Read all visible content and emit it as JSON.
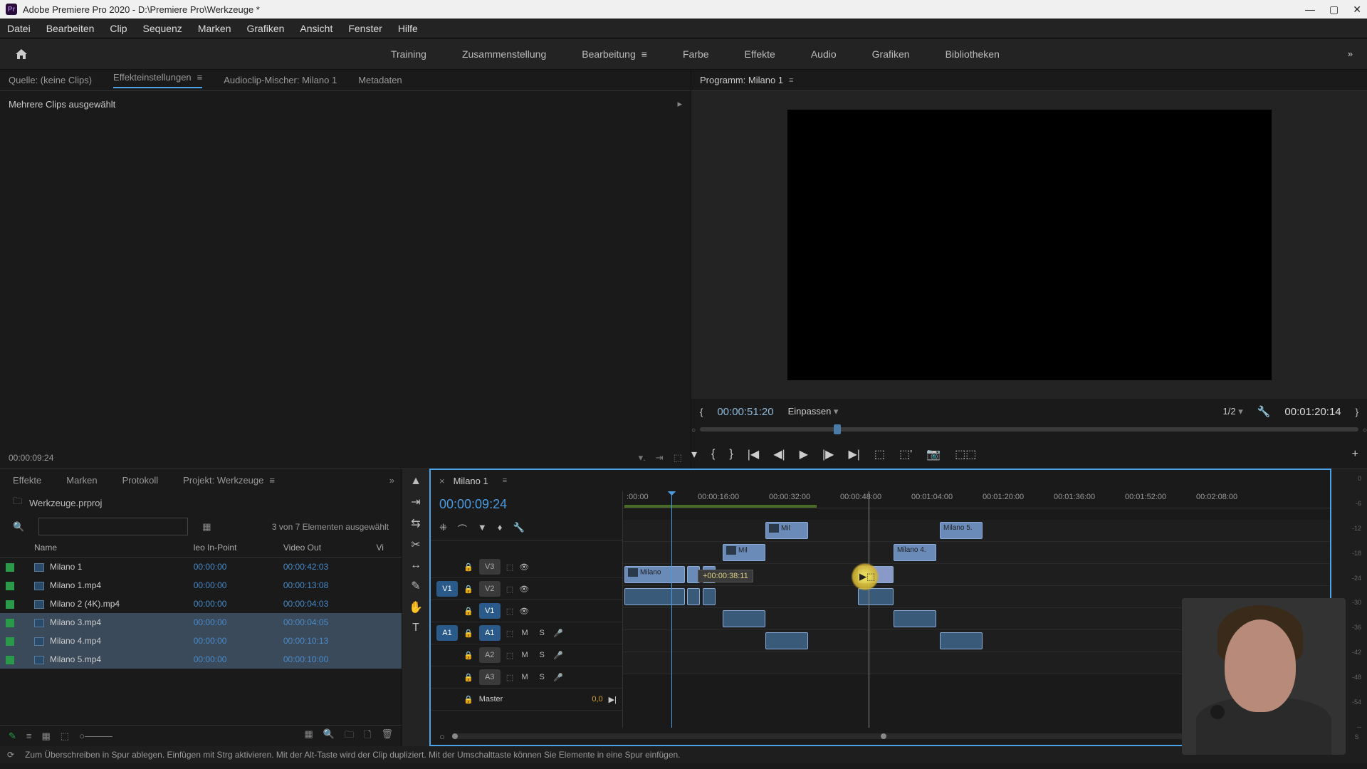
{
  "titlebar": {
    "title": "Adobe Premiere Pro 2020 - D:\\Premiere Pro\\Werkzeuge *"
  },
  "menu": [
    "Datei",
    "Bearbeiten",
    "Clip",
    "Sequenz",
    "Marken",
    "Grafiken",
    "Ansicht",
    "Fenster",
    "Hilfe"
  ],
  "workspaces": {
    "items": [
      "Training",
      "Zusammenstellung",
      "Bearbeitung",
      "Farbe",
      "Effekte",
      "Audio",
      "Grafiken",
      "Bibliotheken"
    ],
    "active": "Bearbeitung"
  },
  "source_tabs": {
    "items": [
      "Quelle: (keine Clips)",
      "Effekteinstellungen",
      "Audioclip-Mischer: Milano 1",
      "Metadaten"
    ],
    "active": "Effekteinstellungen"
  },
  "effect_panel": {
    "message": "Mehrere Clips ausgewählt"
  },
  "source_footer_tc": "00:00:09:24",
  "program": {
    "title": "Programm: Milano 1",
    "tc_left": "00:00:51:20",
    "fit": "Einpassen",
    "ratio": "1/2",
    "tc_right": "00:01:20:14"
  },
  "project_tabs": {
    "items": [
      "Effekte",
      "Marken",
      "Protokoll",
      "Projekt: Werkzeuge"
    ],
    "active": "Projekt: Werkzeuge"
  },
  "project": {
    "filename": "Werkzeuge.prproj",
    "selection_text": "3 von 7 Elementen ausgewählt",
    "columns": [
      "Name",
      "leo In-Point",
      "Video Out",
      "Vi"
    ],
    "rows": [
      {
        "name": "Milano 1",
        "in": "00:00:00",
        "out": "00:00:42:03",
        "selected": false,
        "type": "seq"
      },
      {
        "name": "Milano 1.mp4",
        "in": "00:00:00",
        "out": "00:00:13:08",
        "selected": false,
        "type": "clip"
      },
      {
        "name": "Milano 2 (4K).mp4",
        "in": "00:00:00",
        "out": "00:00:04:03",
        "selected": false,
        "type": "clip"
      },
      {
        "name": "Milano 3.mp4",
        "in": "00:00:00",
        "out": "00:00:04:05",
        "selected": true,
        "type": "clip"
      },
      {
        "name": "Milano 4.mp4",
        "in": "00:00:00",
        "out": "00:00:10:13",
        "selected": true,
        "type": "clip"
      },
      {
        "name": "Milano 5.mp4",
        "in": "00:00:00",
        "out": "00:00:10:00",
        "selected": true,
        "type": "clip"
      }
    ]
  },
  "timeline": {
    "seq_name": "Milano 1",
    "tc": "00:00:09:24",
    "ruler": [
      ":00:00",
      "00:00:16:00",
      "00:00:32:00",
      "00:00:48:00",
      "00:01:04:00",
      "00:01:20:00",
      "00:01:36:00",
      "00:01:52:00",
      "00:02:08:00"
    ],
    "video_tracks": [
      "V3",
      "V2",
      "V1"
    ],
    "audio_tracks": [
      "A1",
      "A2",
      "A3"
    ],
    "master": "Master",
    "master_val": "0,0",
    "tooltip": "+00:00:38:11",
    "clips": {
      "v3": "Mil",
      "v2": "Mil",
      "v1a": "Milano",
      "v2b": "Milano 4.",
      "v3b": "Milano 5."
    }
  },
  "meters": {
    "scale": [
      "0",
      "-6",
      "-12",
      "-18",
      "-24",
      "-30",
      "-36",
      "-42",
      "-48",
      "-54",
      "--"
    ],
    "labels": [
      "S",
      "S"
    ]
  },
  "statusbar": {
    "hint": "Zum Überschreiben in Spur ablegen. Einfügen mit Strg aktivieren. Mit der Alt-Taste wird der Clip dupliziert. Mit der Umschalttaste können Sie Elemente in eine Spur einfügen."
  }
}
